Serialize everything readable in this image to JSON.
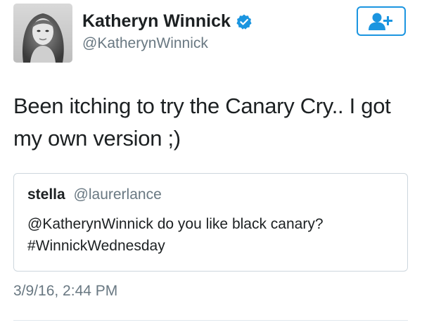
{
  "author": {
    "display_name": "Katheryn Winnick",
    "handle": "@KatherynWinnick",
    "verified": true,
    "avatar_icon": "profile-photo"
  },
  "follow_button": {
    "icon": "add-user-icon",
    "color": "#1b95e0"
  },
  "tweet": {
    "text": "Been itching to try the Canary Cry.. I got my own version ;)",
    "timestamp": "3/9/16, 2:44 PM"
  },
  "quoted_tweet": {
    "name": "stella",
    "handle": "@laurerlance",
    "text_line1": "@KatherynWinnick do you like black canary?",
    "text_line2": "#WinnickWednesday"
  },
  "colors": {
    "text": "#1c2022",
    "muted": "#697882",
    "accent": "#1b95e0",
    "border": "#cdd6dd"
  }
}
